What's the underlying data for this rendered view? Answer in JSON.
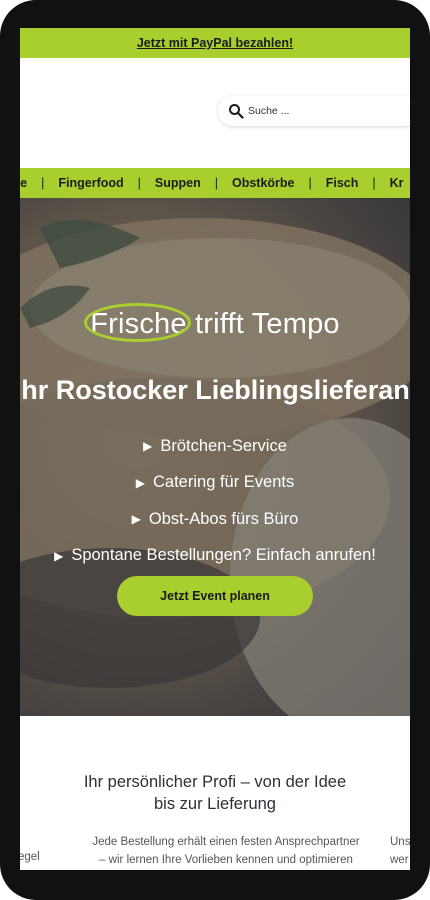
{
  "promo": {
    "text": "Jetzt mit PayPal bezahlen!"
  },
  "search": {
    "placeholder": "Suche ..."
  },
  "nav": {
    "items": [
      "te",
      "Fingerfood",
      "Suppen",
      "Obstkörbe",
      "Fisch",
      "Kr"
    ],
    "separator": "|"
  },
  "hero": {
    "headline_highlight": "Frische",
    "headline_rest": "trifft Tempo",
    "subline": "hr Rostocker Lieblingslieferant",
    "bullets": [
      "Brötchen-Service",
      "Catering für Events",
      "Obst-Abos fürs Büro",
      "Spontane Bestellungen? Einfach anrufen!"
    ],
    "cta": "Jetzt Event planen"
  },
  "section": {
    "title_line1": "Ihr persönlicher Profi – von der Idee",
    "title_line2": "bis zur Lieferung",
    "body_line1": "Jede Bestellung erhält einen festen Ansprechpartner",
    "body_line2": "– wir lernen Ihre Vorlieben kennen und optimieren",
    "left_fragment": "egel",
    "right_line1": "Uns",
    "right_line2": "wer"
  },
  "colors": {
    "accent": "#a9cf2f",
    "frame": "#111111"
  }
}
